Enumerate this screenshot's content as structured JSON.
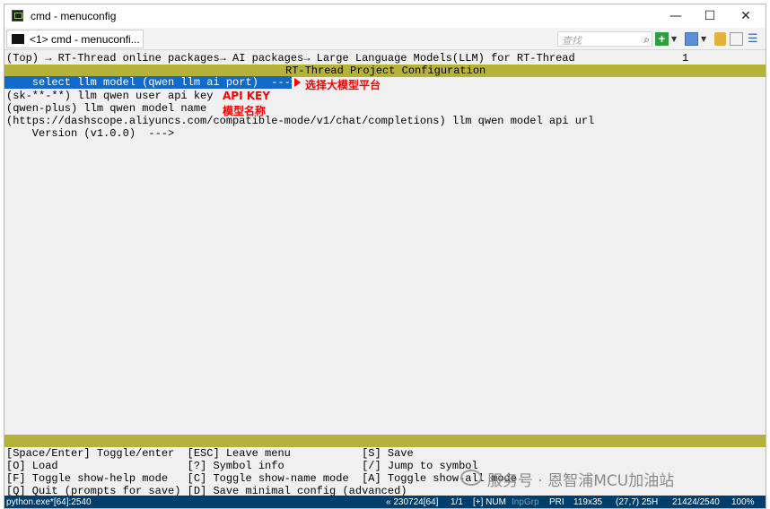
{
  "window": {
    "title": "cmd - menuconfig",
    "controls": {
      "minimize": "—",
      "maximize": "☐",
      "close": "✕"
    }
  },
  "tabbar": {
    "tab_label": "<1> cmd - menuconfi...",
    "search_placeholder": "查找",
    "icons": [
      "search-icon",
      "new-console-icon",
      "dropdown-icon",
      "view-icon",
      "lock-icon",
      "panel-icon",
      "menu-icon"
    ]
  },
  "console": {
    "breadcrumb": "(Top) → RT-Thread online packages→ AI packages→ Large Language Models(LLM) for RT-Thread",
    "breadcrumb_count": "1",
    "header_title": "RT-Thread Project Configuration",
    "items": [
      "    select llm model (qwen llm ai port)  --->",
      "(sk-**-**) llm qwen user api key",
      "(qwen-plus) llm qwen model name",
      "(https://dashscope.aliyuncs.com/compatible-mode/v1/chat/completions) llm qwen model api url",
      "    Version (v1.0.0)  --->"
    ],
    "annotations": {
      "model_platform": "选择大模型平台",
      "api_key": "API KEY",
      "model_name": "模型名称"
    },
    "help": [
      "[Space/Enter] Toggle/enter  [ESC] Leave menu           [S] Save",
      "[O] Load                    [?] Symbol info            [/] Jump to symbol",
      "[F] Toggle show-help mode   [C] Toggle show-name mode  [A] Toggle show-all mode",
      "[Q] Quit (prompts for save) [D] Save minimal config (advanced)"
    ]
  },
  "statusbar": {
    "left": "python.exe*[64]:2540",
    "pos": "« 230724[64]",
    "page": "1/1",
    "mode": "[+] NUM",
    "inpgrp": "InpGrp",
    "pri": "PRI",
    "size": "119x35",
    "cursor": "(27,7) 25H",
    "pid": "21424/2540",
    "zoom": "100%"
  },
  "watermark": {
    "text": "服务号 · 恩智浦MCU加油站"
  },
  "colors": {
    "selection": "#1169c9",
    "header_bar": "#b5b23c",
    "annotation": "#ff0000",
    "statusbar": "#003e6b"
  }
}
